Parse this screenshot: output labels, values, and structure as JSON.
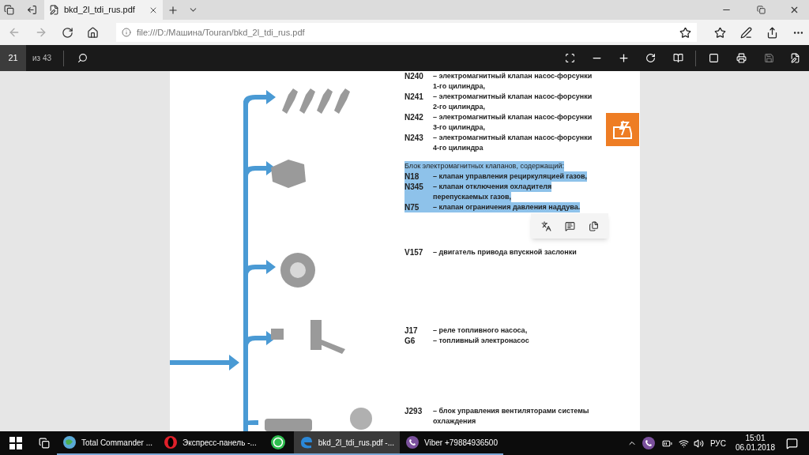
{
  "tab": {
    "title": "bkd_2l_tdi_rus.pdf",
    "selected": true
  },
  "address": {
    "url": "file:///D:/Машина/Touran/bkd_2l_tdi_rus.pdf"
  },
  "pdf_toolbar": {
    "page": "21",
    "page_count": "из 43"
  },
  "document": {
    "groups": [
      {
        "lines": [
          {
            "code": "N240",
            "text": "– электромагнитный клапан насос-форсунки",
            "selected": false
          },
          {
            "text": "1-го цилиндра,",
            "selected": false
          },
          {
            "code": "N241",
            "text": "– электромагнитный клапан насос-форсунки",
            "selected": false
          },
          {
            "text": "2-го цилиндра,",
            "selected": false
          },
          {
            "code": "N242",
            "text": "– электромагнитный клапан насос-форсунки",
            "selected": false
          },
          {
            "text": "3-го цилиндра,",
            "selected": false
          },
          {
            "code": "N243",
            "text": "– электромагнитный клапан насос-форсунки",
            "selected": false
          },
          {
            "text": "4-го цилиндра",
            "selected": false
          }
        ]
      },
      {
        "heading": "Блок электромагнитных клапанов, содержащий:",
        "selected": true,
        "lines": [
          {
            "code": "N18",
            "text": "– клапан управления рециркуляцией газов,",
            "selected": true
          },
          {
            "code": "N345",
            "text": "– клапан отключения охладителя",
            "selected": true
          },
          {
            "text": "перепускаемых газов,",
            "selected": true
          },
          {
            "code": "N75",
            "text": "– клапан ограничения давления наддува.",
            "selected": true
          }
        ]
      },
      {
        "lines": [
          {
            "code": "V157",
            "text": "– двигатель привода впускной заслонки",
            "selected": false
          }
        ]
      },
      {
        "lines": [
          {
            "code": "J17",
            "text": "– реле топливного насоса,",
            "selected": false
          },
          {
            "code": "G6",
            "text": "– топливный электронасос",
            "selected": false
          }
        ]
      },
      {
        "lines": [
          {
            "code": "J293",
            "text": "– блок управления вентиляторами системы",
            "selected": false
          },
          {
            "text": "охлаждения",
            "selected": false
          }
        ]
      }
    ]
  },
  "taskbar": {
    "items": [
      {
        "kind": "total",
        "label": "Total Commander ...",
        "selected": false
      },
      {
        "kind": "opera",
        "label": "Экспресс-панель -...",
        "selected": false
      },
      {
        "kind": "whatsapp",
        "selected": false
      },
      {
        "kind": "edge",
        "label": "bkd_2l_tdi_rus.pdf -...",
        "selected": true
      },
      {
        "kind": "viber",
        "label": "Viber +79884936500",
        "selected": false
      }
    ],
    "language": "РУС",
    "time": "15:01",
    "date": "06.01.2018"
  }
}
